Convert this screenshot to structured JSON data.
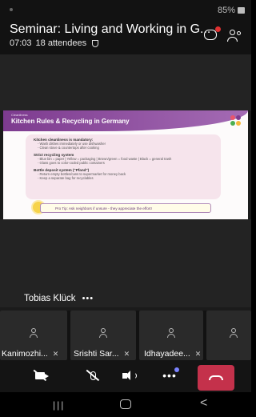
{
  "status_bar": {
    "battery": "85%"
  },
  "meeting": {
    "title": "Seminar: Living and Working in G...",
    "time": "07:03",
    "attendees": "18 attendees"
  },
  "slide": {
    "small_label": "Cleanliness",
    "title": "Kitchen Rules & Recycling in Germany",
    "sections": [
      {
        "heading": "Kitchen cleanliness is mandatory:",
        "lines": [
          "- Wash dishes immediately or use dishwasher",
          "- Clean stove & countertops after cooking"
        ]
      },
      {
        "heading": "Strict recycling system",
        "lines": [
          "- Blue bin = paper | Yellow = packaging | Brown/green = food waste | Black = general trash",
          "- Glass goes to color-coded public containers"
        ]
      },
      {
        "heading": "Bottle deposit system (\"Pfand\")",
        "lines": [
          "- Return empty bottles/cans to supermarket for money back",
          "- Keep a separate bag for recyclables"
        ]
      }
    ],
    "tip": "Pro Tip: Ask neighbors if unsure - they appreciate the effort!",
    "logo_colors": [
      "#e8566c",
      "#7d3b8f",
      "#4caf50",
      "#f6b93b"
    ]
  },
  "presenter": {
    "name": "Tobias Klück",
    "more": "•••"
  },
  "participants": [
    {
      "name": "Kanimozhi..."
    },
    {
      "name": "Srishti Sar..."
    },
    {
      "name": "Idhayadee..."
    },
    {
      "name": ""
    }
  ],
  "toolbar": {
    "more": "•••",
    "leave_color": "#c4314b"
  },
  "navbar": {
    "recent": "|||",
    "back": "<"
  }
}
